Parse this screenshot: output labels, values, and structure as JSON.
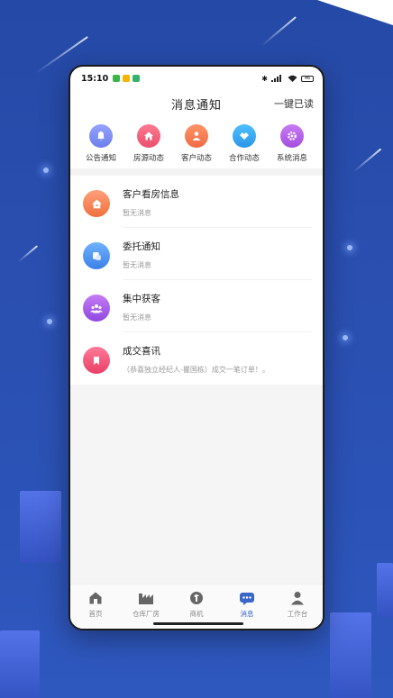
{
  "status_bar": {
    "time": "15:10",
    "right_text": "46"
  },
  "header": {
    "title": "消息通知",
    "action": "一键已读"
  },
  "categories": [
    {
      "label": "公告通知",
      "icon": "bell-icon",
      "color": "#7b8cf0"
    },
    {
      "label": "房源动态",
      "icon": "house-icon",
      "color": "#f2607b"
    },
    {
      "label": "客户动态",
      "icon": "person-icon",
      "color": "#f57a52"
    },
    {
      "label": "合作动态",
      "icon": "handshake-icon",
      "color": "#37a8f0"
    },
    {
      "label": "系统消息",
      "icon": "gear-icon",
      "color": "#b763e6"
    }
  ],
  "messages": [
    {
      "title": "客户看房信息",
      "subtitle": "暂无消息",
      "icon": "house-icon",
      "color": "#f6855c"
    },
    {
      "title": "委托通知",
      "subtitle": "暂无消息",
      "icon": "document-icon",
      "color": "#4f8ff0"
    },
    {
      "title": "集中获客",
      "subtitle": "暂无消息",
      "icon": "group-icon",
      "color": "#a65de6"
    },
    {
      "title": "成交喜讯",
      "subtitle": "（恭喜独立经纪人-瞿国栋）成交一笔订单！。",
      "icon": "bookmark-icon",
      "color": "#f0547a"
    }
  ],
  "tabbar": [
    {
      "label": "首页",
      "icon": "home-icon",
      "active": false
    },
    {
      "label": "仓库厂房",
      "icon": "factory-icon",
      "active": false
    },
    {
      "label": "商机",
      "icon": "opportunity-icon",
      "active": false
    },
    {
      "label": "消息",
      "icon": "message-icon",
      "active": true
    },
    {
      "label": "工作台",
      "icon": "workbench-icon",
      "active": false
    }
  ],
  "colors": {
    "background": "#2a4fb0",
    "accent": "#3a66c8"
  }
}
